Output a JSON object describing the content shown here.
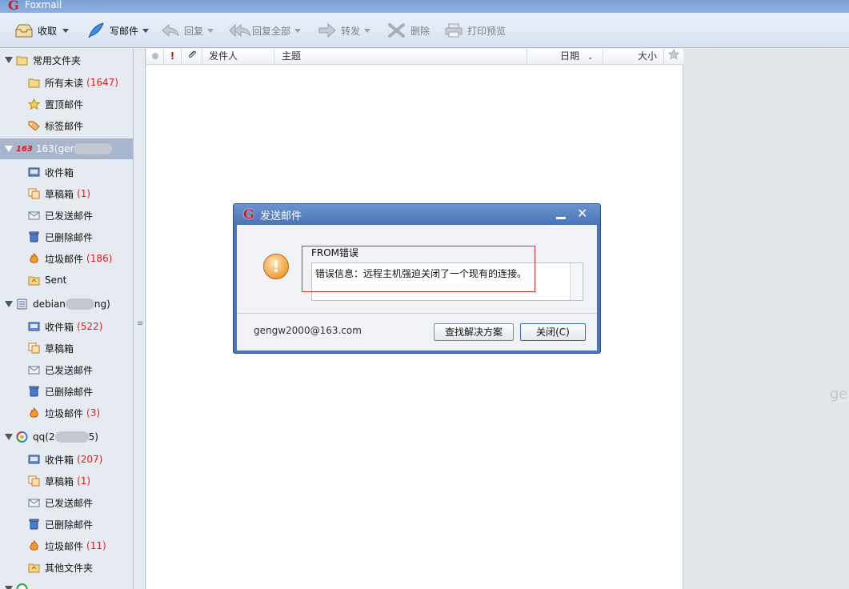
{
  "window": {
    "title": "Foxmail",
    "logo_glyph": "G"
  },
  "toolbar": {
    "receive": "收取",
    "compose": "写邮件",
    "reply": "回复",
    "reply_all": "回复全部",
    "forward": "转发",
    "delete": "删除",
    "print_preview": "打印预览"
  },
  "sidebar": {
    "common_group": "常用文件夹",
    "all_unread": "所有未读",
    "all_unread_count": "(1647)",
    "pinned": "置顶邮件",
    "tagged": "标签邮件",
    "acct1_label": "163(ger",
    "acct1_badge": "163",
    "inbox": "收件箱",
    "drafts": "草稿箱",
    "sent_cn": "已发送邮件",
    "deleted": "已删除邮件",
    "junk": "垃圾邮件",
    "sent_en": "Sent",
    "acct1_drafts_count": "(1)",
    "acct1_junk_count": "(186)",
    "acct2_label_a": "debian",
    "acct2_label_b": "ng)",
    "acct2_inbox_count": "(522)",
    "acct2_junk_count": "(3)",
    "acct3_label_a": "qq(2",
    "acct3_label_b": "5)",
    "acct3_inbox_count": "(207)",
    "acct3_drafts_count": "(1)",
    "acct3_junk_count": "(11)",
    "other_folders": "其他文件夹"
  },
  "maillist": {
    "col_flag": "!",
    "col_sender": "发件人",
    "col_subject": "主题",
    "col_date": "日期",
    "col_size": "大小"
  },
  "rightpane": {
    "ghost_text": "ge"
  },
  "dialog": {
    "title": "发送邮件",
    "error_title": "FROM错误",
    "error_message": "错误信息：远程主机强迫关闭了一个现有的连接。",
    "account": "gengw2000@163.com",
    "find_solution": "查找解决方案",
    "close": "关闭(C)"
  },
  "colors": {
    "accent": "#4a74b5",
    "count_red": "#d92020",
    "highlight": "#e03030"
  }
}
